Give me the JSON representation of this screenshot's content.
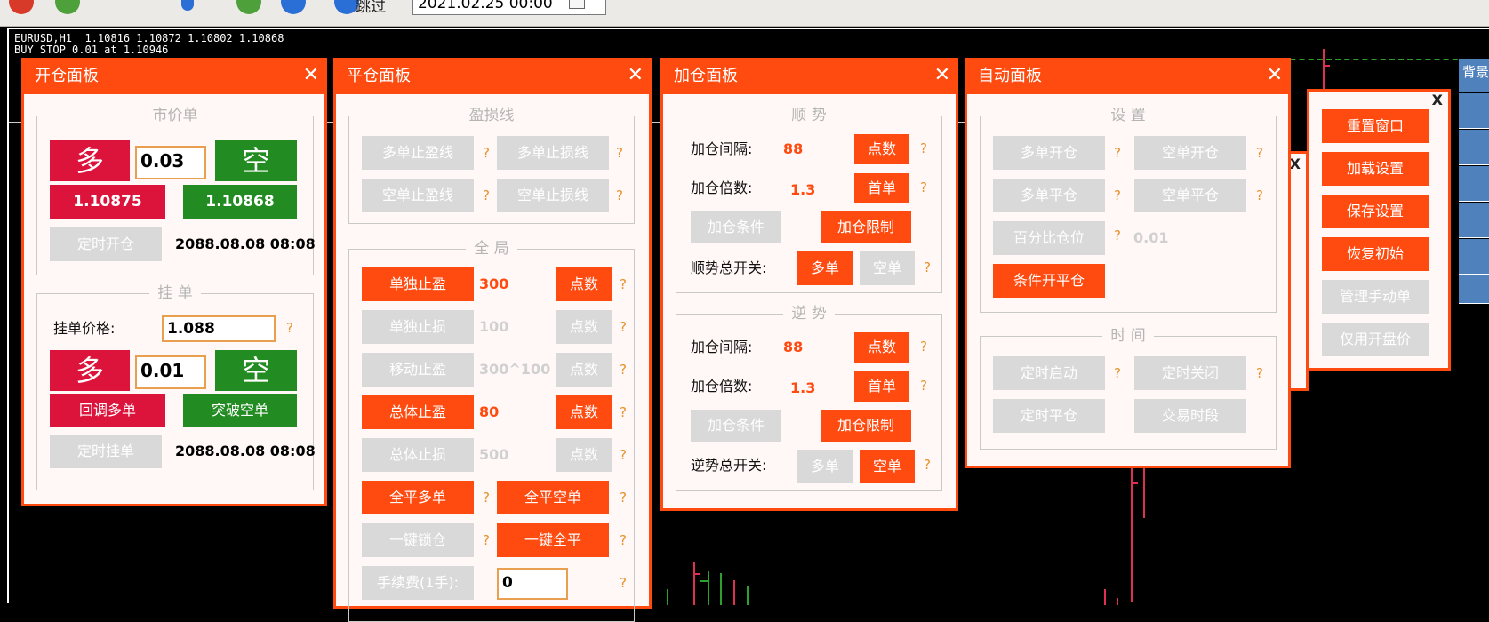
{
  "toolbar": {
    "jump_label": "跳过",
    "date_value": "2021.02.25 00:00"
  },
  "chart": {
    "info_line1": "EURUSD,H1  1.10816 1.10872 1.10802 1.10868",
    "info_line2": "BUY STOP 0.01 at 1.10946",
    "side_tab": "背景"
  },
  "open_panel": {
    "title": "开仓面板",
    "close": "✕",
    "market": {
      "title": "市价单",
      "buy_label": "多",
      "lot": "0.03",
      "sell_label": "空",
      "buy_price": "1.10875",
      "sell_price": "1.10868",
      "timed_label": "定时开仓",
      "timed_value": "2088.08.08 08:08"
    },
    "pending": {
      "title": "挂 单",
      "price_label": "挂单价格:",
      "price_value": "1.088",
      "buy_label": "多",
      "lot": "0.01",
      "sell_label": "空",
      "pullback_label": "回调多单",
      "breakout_label": "突破空单",
      "timed_label": "定时挂单",
      "timed_value": "2088.08.08 08:08"
    }
  },
  "close_panel": {
    "title": "平仓面板",
    "close": "✕",
    "pl": {
      "title": "盈损线",
      "b1": "多单止盈线",
      "b2": "多单止损线",
      "b3": "空单止盈线",
      "b4": "空单止损线"
    },
    "global": {
      "title": "全 局",
      "rows": [
        {
          "label": "单独止盈",
          "value": "300",
          "unit": "点数"
        },
        {
          "label": "单独止损",
          "value": "100",
          "unit": "点数"
        },
        {
          "label": "移动止盈",
          "value": "300^100",
          "unit": "点数"
        },
        {
          "label": "总体止盈",
          "value": "80",
          "unit": "点数"
        },
        {
          "label": "总体止损",
          "value": "500",
          "unit": "点数"
        }
      ],
      "close_buy": "全平多单",
      "close_sell": "全平空单",
      "lock": "一键锁仓",
      "close_all": "一键全平",
      "fee_label": "手续费(1手):",
      "fee_value": "0"
    }
  },
  "add_panel": {
    "title": "加仓面板",
    "close": "✕",
    "trend": {
      "title": "顺 势",
      "interval_label": "加仓间隔:",
      "interval_value": "88",
      "interval_unit": "点数",
      "mult_label": "加仓倍数:",
      "mult_value": "1.3",
      "mult_unit": "首单",
      "cond": "加仓条件",
      "limit": "加仓限制",
      "switch_label": "顺势总开关:",
      "long": "多单",
      "short": "空单"
    },
    "counter": {
      "title": "逆 势",
      "interval_label": "加仓间隔:",
      "interval_value": "88",
      "interval_unit": "点数",
      "mult_label": "加仓倍数:",
      "mult_value": "1.3",
      "mult_unit": "首单",
      "cond": "加仓条件",
      "limit": "加仓限制",
      "switch_label": "逆势总开关:",
      "long": "多单",
      "short": "空单"
    }
  },
  "auto_panel": {
    "title": "自动面板",
    "close": "✕",
    "settings": {
      "title": "设 置",
      "b1": "多单开仓",
      "b2": "空单开仓",
      "b3": "多单平仓",
      "b4": "空单平仓",
      "b5": "百分比仓位",
      "b5_value": "0.01",
      "b6": "条件开平仓"
    },
    "time": {
      "title": "时 间",
      "b1": "定时启动",
      "b2": "定时关闭",
      "b3": "定时平仓",
      "b4": "交易时段"
    }
  },
  "reset_panel": {
    "close": "X",
    "close_behind": "X",
    "items": [
      "重置窗口",
      "加载设置",
      "保存设置",
      "恢复初始",
      "管理手动单",
      "仅用开盘价"
    ]
  },
  "help": "?"
}
